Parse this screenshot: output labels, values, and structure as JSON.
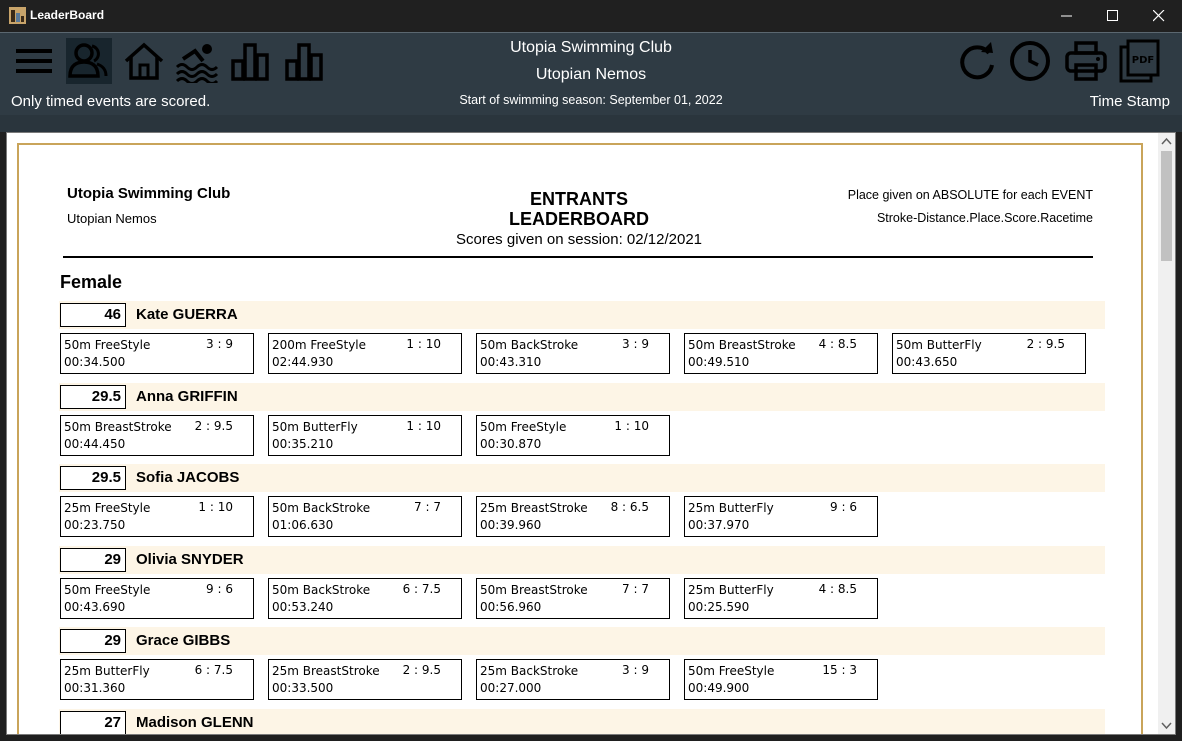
{
  "window": {
    "title": "LeaderBoard"
  },
  "toolbar": {
    "notice": "Only timed events are scored.",
    "club": "Utopia Swimming Club",
    "team": "Utopian Nemos",
    "season": "Start of swimming season: September 01, 2022",
    "timestamp_label": "Time Stamp",
    "icons": [
      "menu-icon",
      "entrants-icon",
      "home-icon",
      "swimming-icon",
      "bar-chart-icon",
      "bar-chart-icon",
      "refresh-icon",
      "clock-icon",
      "print-icon",
      "pdf-icon"
    ]
  },
  "report": {
    "club": "Utopia Swimming Club",
    "team": "Utopian Nemos",
    "title_line1": "ENTRANTS",
    "title_line2": "LEADERBOARD",
    "session": "Scores given on session: 02/12/2021",
    "place_note": "Place given on ABSOLUTE for each EVENT",
    "format_note": "Stroke-Distance.Place.Score.Racetime",
    "gender": "Female",
    "entrants": [
      {
        "score": "46",
        "name": "Kate GUERRA",
        "events": [
          {
            "name": "50m FreeStyle",
            "place_score": "3 : 9",
            "time": "00:34.500"
          },
          {
            "name": "200m FreeStyle",
            "place_score": "1 : 10",
            "time": "02:44.930"
          },
          {
            "name": "50m BackStroke",
            "place_score": "3 : 9",
            "time": "00:43.310"
          },
          {
            "name": "50m BreastStroke",
            "place_score": "4 : 8.5",
            "time": "00:49.510"
          },
          {
            "name": "50m ButterFly",
            "place_score": "2 : 9.5",
            "time": "00:43.650"
          }
        ]
      },
      {
        "score": "29.5",
        "name": "Anna GRIFFIN",
        "events": [
          {
            "name": "50m BreastStroke",
            "place_score": "2 : 9.5",
            "time": "00:44.450"
          },
          {
            "name": "50m ButterFly",
            "place_score": "1 : 10",
            "time": "00:35.210"
          },
          {
            "name": "50m FreeStyle",
            "place_score": "1 : 10",
            "time": "00:30.870"
          }
        ]
      },
      {
        "score": "29.5",
        "name": "Sofia JACOBS",
        "events": [
          {
            "name": "25m FreeStyle",
            "place_score": "1 : 10",
            "time": "00:23.750"
          },
          {
            "name": "50m BackStroke",
            "place_score": "7 : 7",
            "time": "01:06.630"
          },
          {
            "name": "25m BreastStroke",
            "place_score": "8 : 6.5",
            "time": "00:39.960"
          },
          {
            "name": "25m ButterFly",
            "place_score": "9 : 6",
            "time": "00:37.970"
          }
        ]
      },
      {
        "score": "29",
        "name": "Olivia SNYDER",
        "events": [
          {
            "name": "50m FreeStyle",
            "place_score": "9 : 6",
            "time": "00:43.690"
          },
          {
            "name": "50m BackStroke",
            "place_score": "6 : 7.5",
            "time": "00:53.240"
          },
          {
            "name": "50m BreastStroke",
            "place_score": "7 : 7",
            "time": "00:56.960"
          },
          {
            "name": "25m ButterFly",
            "place_score": "4 : 8.5",
            "time": "00:25.590"
          }
        ]
      },
      {
        "score": "29",
        "name": "Grace GIBBS",
        "events": [
          {
            "name": "25m ButterFly",
            "place_score": "6 : 7.5",
            "time": "00:31.360"
          },
          {
            "name": "25m BreastStroke",
            "place_score": "2 : 9.5",
            "time": "00:33.500"
          },
          {
            "name": "25m BackStroke",
            "place_score": "3 : 9",
            "time": "00:27.000"
          },
          {
            "name": "50m FreeStyle",
            "place_score": "15 : 3",
            "time": "00:49.900"
          }
        ]
      },
      {
        "score": "27",
        "name": "Madison GLENN",
        "events": []
      }
    ]
  }
}
